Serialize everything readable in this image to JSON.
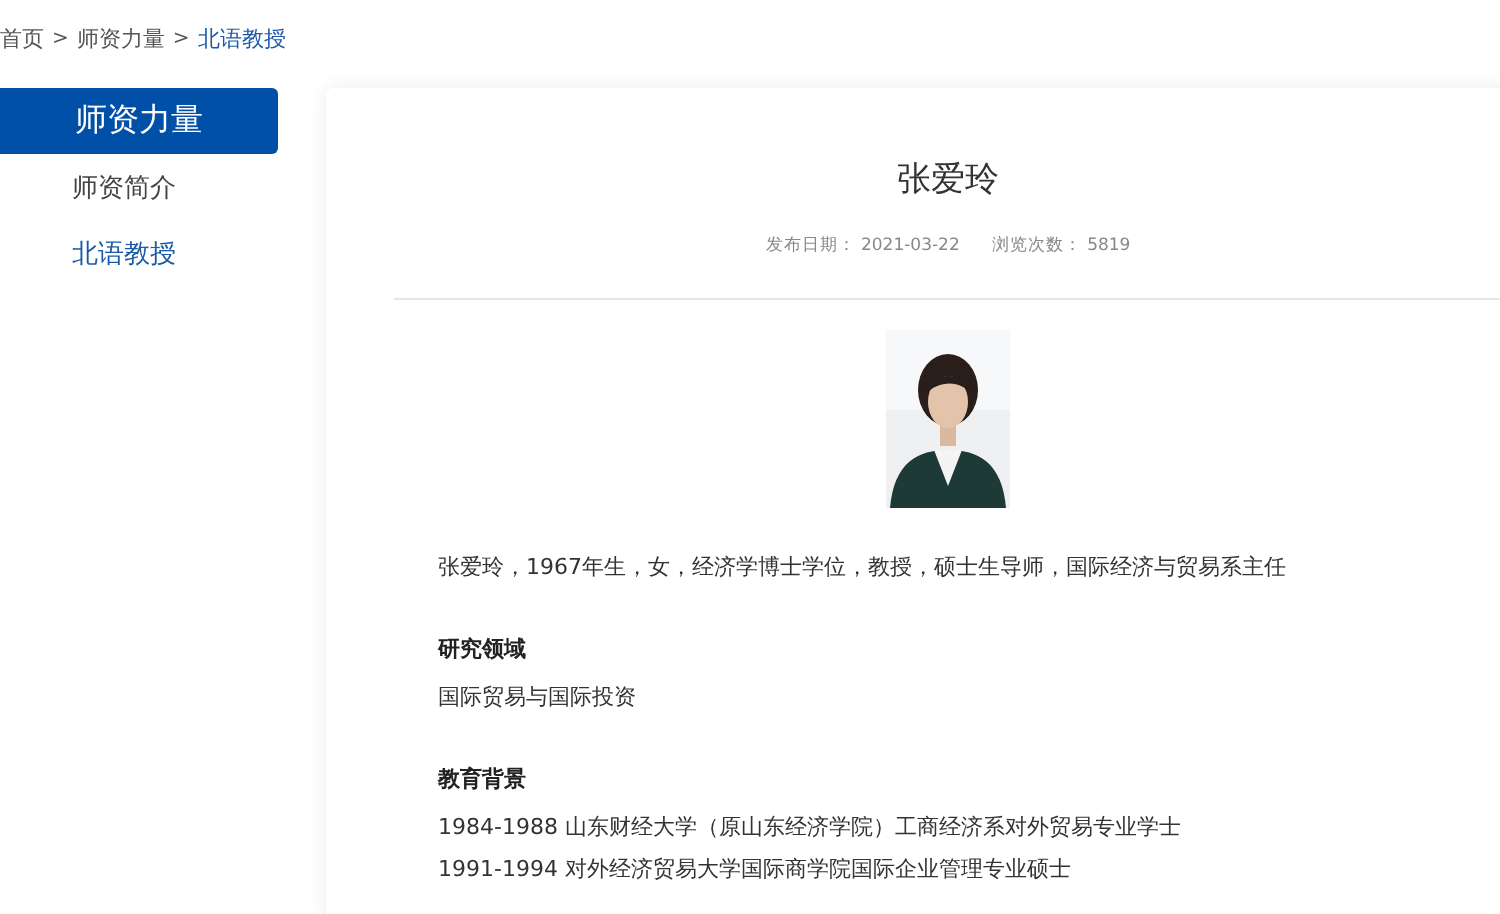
{
  "breadcrumb": [
    {
      "label": "首页",
      "current": false
    },
    {
      "label": "师资力量",
      "current": false
    },
    {
      "label": "北语教授",
      "current": true
    }
  ],
  "breadcrumb_separator": ">",
  "sidebar": {
    "title": "师资力量",
    "items": [
      {
        "label": "师资简介",
        "selected": false
      },
      {
        "label": "北语教授",
        "selected": true
      }
    ]
  },
  "article": {
    "title": "张爱玲",
    "date_label": "发布日期：",
    "date": "2021-03-22",
    "views_label": "浏览次数：",
    "views": "5819",
    "intro": "张爱玲，1967年生，女，经济学博士学位，教授，硕士生导师，国际经济与贸易系主任",
    "sections": [
      {
        "heading": "研究领域",
        "lines": [
          "国际贸易与国际投资"
        ]
      },
      {
        "heading": "教育背景",
        "lines": [
          "1984-1988  山东财经大学（原山东经济学院）工商经济系对外贸易专业学士",
          "1991-1994  对外经济贸易大学国际商学院国际企业管理专业硕士"
        ]
      }
    ]
  }
}
